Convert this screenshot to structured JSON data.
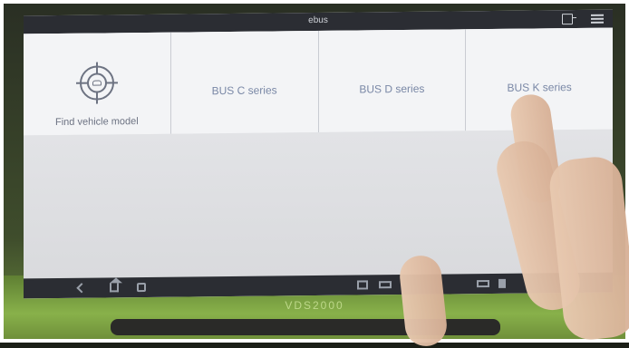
{
  "window": {
    "title": "ebus"
  },
  "icons": {
    "exit": "exit-icon",
    "menu": "menu-icon",
    "find_vehicle": "target-icon",
    "nav_back": "back-icon",
    "nav_home": "home-icon",
    "nav_recent": "recent-apps-icon",
    "screenshot": "screenshot-icon",
    "keyboard": "keyboard-icon",
    "battery": "battery-icon",
    "sd": "sd-card-icon"
  },
  "tiles": [
    {
      "label": "Find vehicle model"
    },
    {
      "label": "BUS C series"
    },
    {
      "label": "BUS D series"
    },
    {
      "label": "BUS K series"
    }
  ],
  "device": {
    "brand": "VDS2000"
  },
  "colors": {
    "status_bar": "#2b2d33",
    "tile_bg": "#f3f4f6",
    "tile_text": "#7a88a6",
    "device_body": "#6f8f3a"
  }
}
